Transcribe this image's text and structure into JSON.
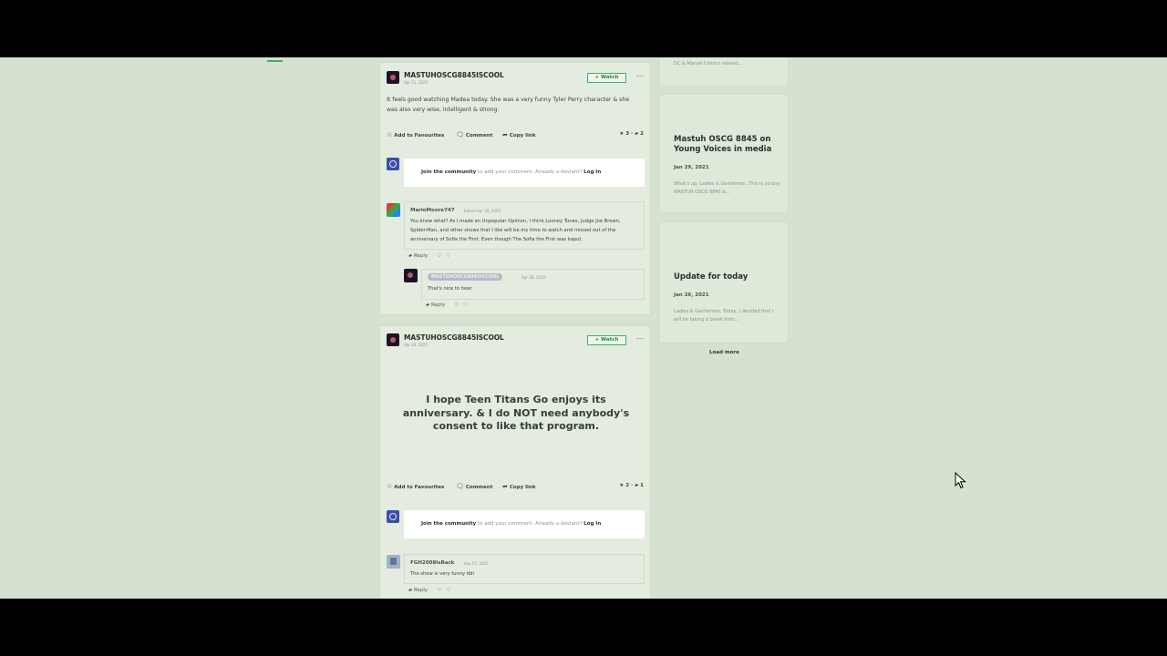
{
  "post1": {
    "author": "MASTUHOSCG8845ISCOOL",
    "date": "Apr 21, 2025",
    "watch_label": "+ Watch",
    "text": "It feels good watching Madea today. She was a very funny Tyler Perry character & she was also very wise, intelligent & strong.",
    "actions": {
      "favourites": "Add to Favourites",
      "comment": "Comment",
      "copy_link": "Copy link"
    },
    "stats": {
      "favs": "3",
      "comments": "2"
    },
    "join": {
      "link": "Join the community",
      "text": " to add your comment. Already a deviant? ",
      "login": "Log In"
    },
    "comments": [
      {
        "author": "MarioMoore747",
        "meta": "Edited Apr 28, 2025",
        "text": "You know what? As I made an Unpopular Opinion, I think Looney Tunes, Judge Joe Brown, Spider-Man, and other shows that I like will be my time to watch and missed out of the anniversary of Sofia the First. Even though The Sofia the First was kaput.",
        "reply": "Reply"
      },
      {
        "author": "MASTUHOSCG8845ISCOOL",
        "meta": "Apr 28, 2025",
        "text": "That's nice to hear.",
        "reply": "Reply"
      }
    ]
  },
  "post2": {
    "author": "MASTUHOSCG8845ISCOOL",
    "date": "Apr 24, 2025",
    "watch_label": "+ Watch",
    "text": "I hope Teen Titans Go enjoys its anniversary. & I do NOT need anybody's consent to like that program.",
    "actions": {
      "favourites": "Add to Favourites",
      "comment": "Comment",
      "copy_link": "Copy link"
    },
    "stats": {
      "favs": "2",
      "comments": "1"
    },
    "join": {
      "link": "Join the community",
      "text": " to add your comment. Already a deviant? ",
      "login": "Log In"
    },
    "comments": [
      {
        "author": "FGH2008IsBack",
        "meta": "Sep 27, 2025",
        "text": "The show is very funny tbh",
        "reply": "Reply"
      }
    ]
  },
  "sidebar": {
    "top_excerpt": "DC & Marvel Comics related...",
    "journals": [
      {
        "title": "Mastuh OSCG 8845 on Young Voices in media",
        "date": "Jan 29, 2021",
        "excerpt": "What's up, Ladies & Gentlemen. This is yo boy MASTUH OSCG 8845 &..."
      },
      {
        "title": "Update for today",
        "date": "Jan 26, 2021",
        "excerpt": "Ladies & Gentlemen. Today, I decided that I will be taking a break from..."
      }
    ],
    "load_more": "Load more"
  },
  "icons": {
    "star": "star-icon",
    "comment": "comment-icon",
    "share": "share-icon",
    "heart": "heart-icon",
    "dislike": "broken-heart-icon",
    "cursor": "mouse-cursor-icon"
  },
  "colors": {
    "accent": "#3fae6a",
    "page_bg": "#d6e2d0"
  }
}
